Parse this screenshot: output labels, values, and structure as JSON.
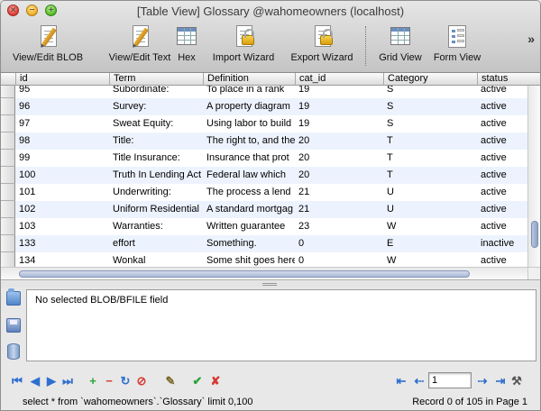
{
  "window": {
    "title": "[Table View] Glossary @wahomeowners (localhost)"
  },
  "toolbar": {
    "buttons": [
      {
        "label": "View/Edit BLOB",
        "icon": "edit-blob-icon"
      },
      {
        "label": "View/Edit Text",
        "icon": "edit-text-icon"
      },
      {
        "label": "Hex",
        "icon": "hex-grid-icon"
      },
      {
        "label": "Import Wizard",
        "icon": "import-wizard-icon"
      },
      {
        "label": "Export Wizard",
        "icon": "export-wizard-icon"
      },
      {
        "label": "Grid View",
        "icon": "grid-view-icon"
      },
      {
        "label": "Form View",
        "icon": "form-view-icon"
      }
    ],
    "overflow": "»"
  },
  "table": {
    "columns": [
      "id",
      "Term",
      "Definition",
      "cat_id",
      "Category",
      "status"
    ],
    "rows": [
      [
        "95",
        "Subordinate:",
        "To place in a rank",
        "19",
        "S",
        "active"
      ],
      [
        "96",
        "Survey:",
        "A property diagram",
        "19",
        "S",
        "active"
      ],
      [
        "97",
        "Sweat Equity:",
        "Using labor to build",
        "19",
        "S",
        "active"
      ],
      [
        "98",
        "Title:",
        "The right to, and the",
        "20",
        "T",
        "active"
      ],
      [
        "99",
        "Title Insurance:",
        "Insurance that prot",
        "20",
        "T",
        "active"
      ],
      [
        "100",
        "Truth In Lending Act",
        "Federal law which",
        "20",
        "T",
        "active"
      ],
      [
        "101",
        "Underwriting:",
        "The process a lend",
        "21",
        "U",
        "active"
      ],
      [
        "102",
        "Uniform Residential",
        "A standard mortgag",
        "21",
        "U",
        "active"
      ],
      [
        "103",
        "Warranties:",
        "Written guarantee",
        "23",
        "W",
        "active"
      ],
      [
        "133",
        "effort",
        "Something.",
        "0",
        "E",
        "inactive"
      ],
      [
        "134",
        "Wonkal",
        "Some shit goes here",
        "0",
        "W",
        "active"
      ]
    ]
  },
  "blob": {
    "message": "No selected BLOB/BFILE field",
    "tools": [
      "open-folder-icon",
      "save-disk-icon",
      "database-icon"
    ]
  },
  "nav": {
    "first": "first-record-icon",
    "prev": "prev-record-icon",
    "next": "next-record-icon",
    "last": "last-record-icon",
    "page_value": "1"
  },
  "status": {
    "sql": "select * from `wahomeowners`.`Glossary` limit 0,100",
    "record": "Record 0 of 105 in Page 1"
  },
  "colors": {
    "alt_row": "#edf3fe",
    "nav_blue": "#2f6fd0",
    "add_green": "#2aa53a",
    "delete_red": "#d73a34"
  }
}
